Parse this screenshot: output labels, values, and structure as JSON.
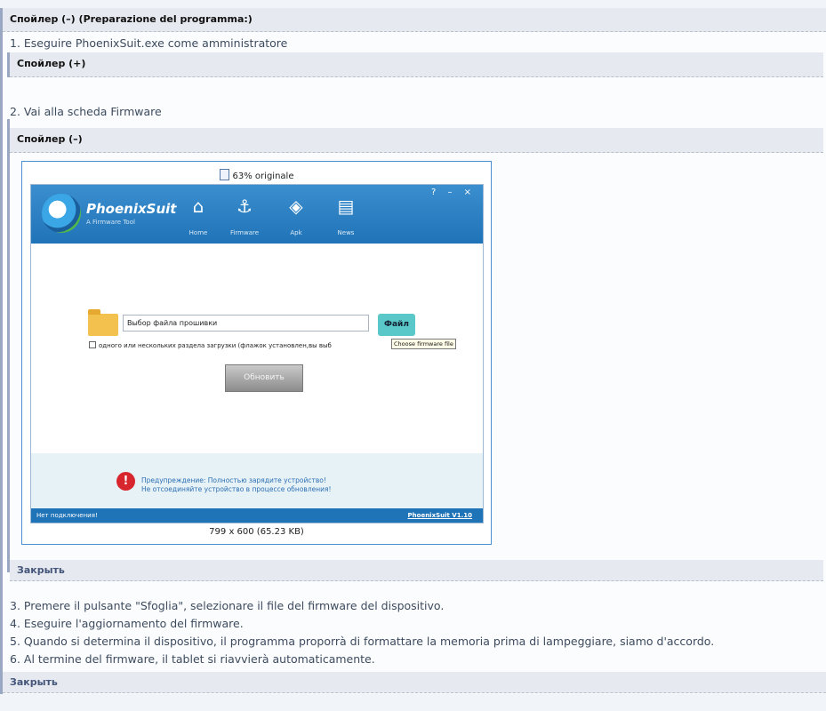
{
  "spoiler_main": {
    "header": "Спойлер (–) (Preparazione del programma:)",
    "close_label": "Закрыть"
  },
  "steps": {
    "s1": "1. Eseguire PhoenixSuit.exe come amministratore",
    "s2": "2. Vai alla scheda Firmware",
    "s3": "3. Premere il pulsante \"Sfoglia\", selezionare il file del firmware del dispositivo.",
    "s4": "4. Eseguire l'aggiornamento del firmware.",
    "s5": "5. Quando si determina il dispositivo, il programma proporrà di formattare la memoria prima di lampeggiare, siamo d'accordo.",
    "s6": "6. Al termine del firmware, il tablet si riavvierà automaticamente."
  },
  "spoiler_collapsed": {
    "header": "Спойлер (+)"
  },
  "spoiler_expanded": {
    "header": "Спойлер (–)",
    "close_label": "Закрыть"
  },
  "image": {
    "zoom_label": "63% originale",
    "caption": "799 x 600 (65.23 KB)"
  },
  "app": {
    "logo_name": "PhoenixSuit",
    "logo_sub": "A Firmware Tool",
    "window_controls": "? – ×",
    "nav": [
      {
        "label": "Home"
      },
      {
        "label": "Firmware"
      },
      {
        "label": "Apk"
      },
      {
        "label": "News"
      }
    ],
    "file_path_value": "Выбор файла прошивки",
    "file_button": "Файл",
    "tooltip": "Choose firmware file",
    "checkbox_label": "одного или нескольких раздела загрузки (флажок установлен,вы выб",
    "update_button": "Обновить",
    "warning_line1": "Предупреждение: Полностью зарядите устройство!",
    "warning_line2": "Не отсоединяйте устройство в процессе обновления!",
    "status_left": "Нет подключения!",
    "version": "PhoenixSuit V1.10"
  },
  "colors": {
    "accent": "#1f73b7",
    "file_button": "#5ac7c8",
    "warning": "#d8262e"
  }
}
